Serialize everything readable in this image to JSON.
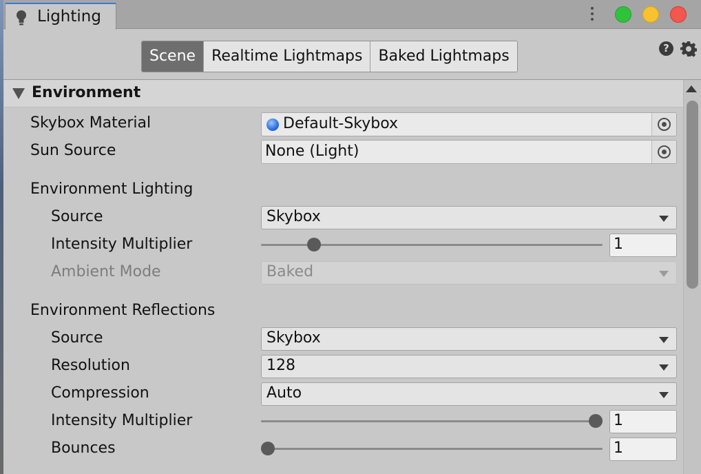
{
  "window": {
    "tab_title": "Lighting",
    "tab_icon": "lightbulb-icon",
    "controls": [
      "menu-kebab-icon",
      "maximize-button",
      "minimize-button",
      "close-button"
    ],
    "traffic_colors": {
      "green": "#2ec33b",
      "yellow": "#f7c22f",
      "red": "#f3574d"
    }
  },
  "toolbar": {
    "tabs": [
      {
        "label": "Scene",
        "active": true
      },
      {
        "label": "Realtime Lightmaps",
        "active": false
      },
      {
        "label": "Baked Lightmaps",
        "active": false
      }
    ],
    "icons": [
      "help-icon",
      "gear-icon"
    ],
    "help_glyph": "?"
  },
  "section": {
    "title": "Environment",
    "expanded": true
  },
  "fields": {
    "skybox_material": {
      "label": "Skybox Material",
      "value": "Default-Skybox",
      "icon": "material-sphere-icon"
    },
    "sun_source": {
      "label": "Sun Source",
      "value": "None (Light)"
    },
    "env_lighting": {
      "heading": "Environment Lighting",
      "source": {
        "label": "Source",
        "value": "Skybox"
      },
      "intensity": {
        "label": "Intensity Multiplier",
        "value": "1",
        "slider_fraction": 0.14
      },
      "ambient_mode": {
        "label": "Ambient Mode",
        "value": "Baked",
        "disabled": true
      }
    },
    "env_reflections": {
      "heading": "Environment Reflections",
      "source": {
        "label": "Source",
        "value": "Skybox"
      },
      "resolution": {
        "label": "Resolution",
        "value": "128"
      },
      "compression": {
        "label": "Compression",
        "value": "Auto"
      },
      "intensity": {
        "label": "Intensity Multiplier",
        "value": "1",
        "slider_fraction": 1.0
      },
      "bounces": {
        "label": "Bounces",
        "value": "1",
        "slider_fraction": 0.0
      }
    }
  },
  "colors": {
    "active_tab": "#6e6e6e",
    "accent": "#3a79d7"
  }
}
